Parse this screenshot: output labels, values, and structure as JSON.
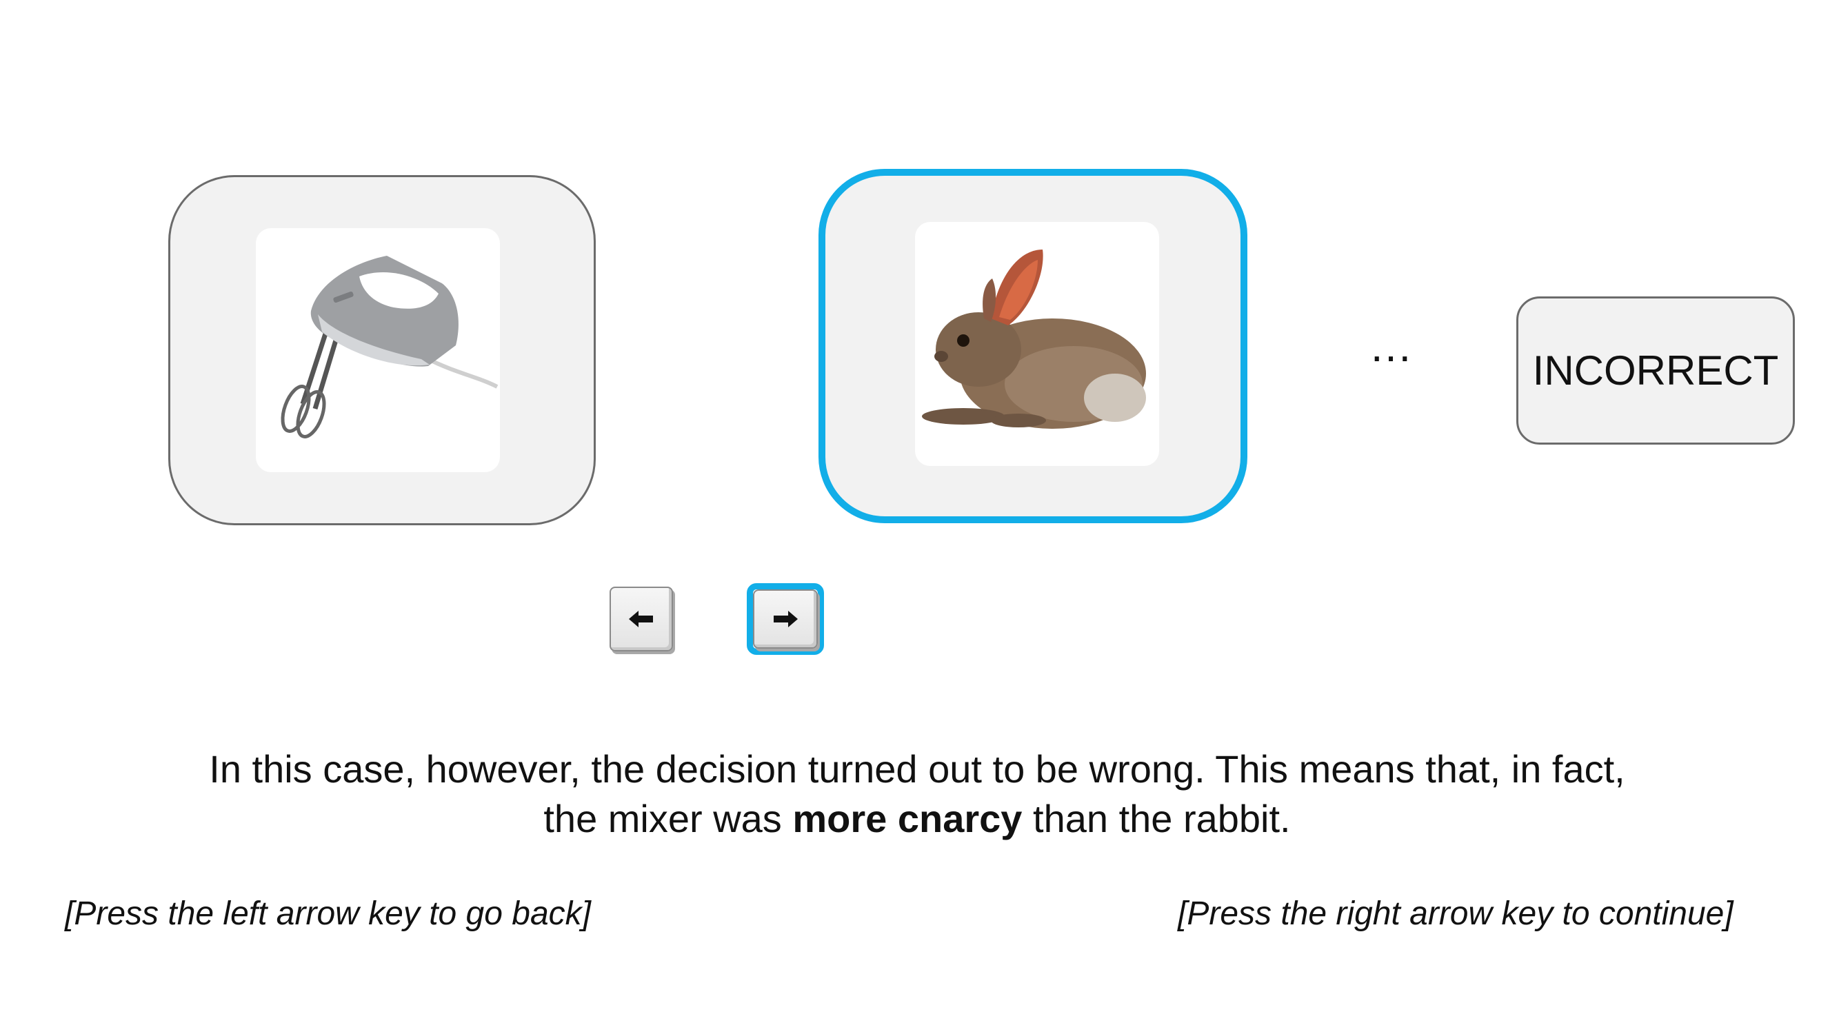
{
  "stimuli": {
    "left": {
      "icon": "hand-mixer-image",
      "label": "mixer",
      "selected": false
    },
    "right": {
      "icon": "rabbit-image",
      "label": "rabbit",
      "selected": true
    }
  },
  "ellipsis": "…",
  "feedback": {
    "text": "INCORRECT"
  },
  "keys": {
    "left": {
      "icon": "left-arrow-icon"
    },
    "right": {
      "icon": "right-arrow-icon",
      "highlighted": true
    }
  },
  "message": {
    "line1": "In this case, however, the decision turned out to be wrong. This means that, in fact,",
    "line2_before": "the mixer was ",
    "line2_bold": "more cnarcy",
    "line2_after": " than the rabbit."
  },
  "hints": {
    "back": "[Press the left arrow key to go back]",
    "continue": "[Press the right arrow key to continue]"
  },
  "colors": {
    "highlight": "#12aee8",
    "card_fill": "#f2f2f2",
    "card_border": "#6b6b6b"
  }
}
